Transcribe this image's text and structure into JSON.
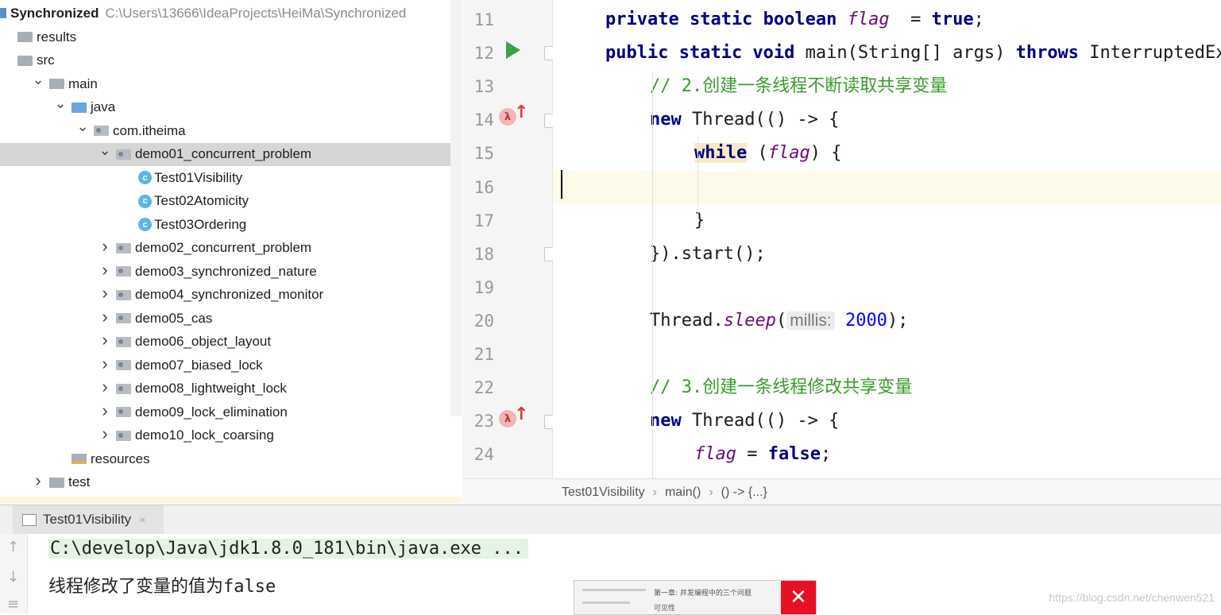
{
  "project": {
    "name": "Synchronized",
    "path": "C:\\Users\\13666\\IdeaProjects\\HeiMa\\Synchronized",
    "items": [
      {
        "label": "results",
        "indent": 0,
        "chevron": "",
        "icon": "folder"
      },
      {
        "label": "src",
        "indent": 0,
        "chevron": "",
        "icon": "folder"
      },
      {
        "label": "main",
        "indent": 1,
        "chevron": "down",
        "icon": "folder"
      },
      {
        "label": "java",
        "indent": 2,
        "chevron": "down",
        "icon": "folder-blue"
      },
      {
        "label": "com.itheima",
        "indent": 3,
        "chevron": "down",
        "icon": "package"
      },
      {
        "label": "demo01_concurrent_problem",
        "indent": 4,
        "chevron": "down",
        "icon": "package",
        "selected": true
      },
      {
        "label": "Test01Visibility",
        "indent": 5,
        "chevron": "",
        "icon": "class"
      },
      {
        "label": "Test02Atomicity",
        "indent": 5,
        "chevron": "",
        "icon": "class"
      },
      {
        "label": "Test03Ordering",
        "indent": 5,
        "chevron": "",
        "icon": "class"
      },
      {
        "label": "demo02_concurrent_problem",
        "indent": 4,
        "chevron": "right",
        "icon": "package"
      },
      {
        "label": "demo03_synchronized_nature",
        "indent": 4,
        "chevron": "right",
        "icon": "package"
      },
      {
        "label": "demo04_synchronized_monitor",
        "indent": 4,
        "chevron": "right",
        "icon": "package"
      },
      {
        "label": "demo05_cas",
        "indent": 4,
        "chevron": "right",
        "icon": "package"
      },
      {
        "label": "demo06_object_layout",
        "indent": 4,
        "chevron": "right",
        "icon": "package"
      },
      {
        "label": "demo07_biased_lock",
        "indent": 4,
        "chevron": "right",
        "icon": "package"
      },
      {
        "label": "demo08_lightweight_lock",
        "indent": 4,
        "chevron": "right",
        "icon": "package"
      },
      {
        "label": "demo09_lock_elimination",
        "indent": 4,
        "chevron": "right",
        "icon": "package"
      },
      {
        "label": "demo10_lock_coarsing",
        "indent": 4,
        "chevron": "right",
        "icon": "package"
      },
      {
        "label": "resources",
        "indent": 2,
        "chevron": "",
        "icon": "folder-res"
      },
      {
        "label": "test",
        "indent": 1,
        "chevron": "right",
        "icon": "folder"
      }
    ]
  },
  "editor": {
    "lines": [
      {
        "n": "11",
        "indent": 1,
        "tokens": [
          [
            "kw",
            "private static boolean "
          ],
          [
            "fld",
            "flag"
          ],
          [
            "",
            "  = "
          ],
          [
            "kw",
            "true"
          ],
          [
            "",
            ";"
          ]
        ]
      },
      {
        "n": "12",
        "indent": 1,
        "tokens": [
          [
            "kw",
            "public static void "
          ],
          [
            "",
            "main(String[] args) "
          ],
          [
            "kw",
            "throws "
          ],
          [
            "",
            "InterruptedException"
          ]
        ]
      },
      {
        "n": "13",
        "indent": 2,
        "tokens": [
          [
            "cm",
            "// 2.创建一条线程不断读取共享变量"
          ]
        ]
      },
      {
        "n": "14",
        "indent": 2,
        "tokens": [
          [
            "kw",
            "new "
          ],
          [
            "",
            "Thread(() -> {"
          ]
        ]
      },
      {
        "n": "15",
        "indent": 3,
        "tokens": [
          [
            "kw-while",
            "while"
          ],
          [
            "",
            " ("
          ],
          [
            "fld",
            "flag"
          ],
          [
            "",
            ") {"
          ]
        ]
      },
      {
        "n": "16",
        "indent": 0,
        "tokens": []
      },
      {
        "n": "17",
        "indent": 3,
        "tokens": [
          [
            "",
            "}"
          ]
        ]
      },
      {
        "n": "18",
        "indent": 2,
        "tokens": [
          [
            "",
            "}).start();"
          ]
        ]
      },
      {
        "n": "19",
        "indent": 0,
        "tokens": []
      },
      {
        "n": "20",
        "indent": 2,
        "tokens": [
          [
            "",
            "Thread."
          ],
          [
            "fld-it",
            "sleep"
          ],
          [
            "",
            "("
          ],
          [
            "hint",
            "millis:"
          ],
          [
            "num",
            " 2000"
          ],
          [
            "",
            ");"
          ]
        ]
      },
      {
        "n": "21",
        "indent": 0,
        "tokens": []
      },
      {
        "n": "22",
        "indent": 2,
        "tokens": [
          [
            "cm",
            "// 3.创建一条线程修改共享变量"
          ]
        ]
      },
      {
        "n": "23",
        "indent": 2,
        "tokens": [
          [
            "kw",
            "new "
          ],
          [
            "",
            "Thread(() -> {"
          ]
        ]
      },
      {
        "n": "24",
        "indent": 3,
        "tokens": [
          [
            "fld",
            "flag"
          ],
          [
            "",
            " = "
          ],
          [
            "kw",
            "false"
          ],
          [
            "",
            ";"
          ]
        ]
      }
    ]
  },
  "breadcrumb": {
    "items": [
      "Test01Visibility",
      "main()",
      "() -> {...}"
    ]
  },
  "run": {
    "tab_label": "Test01Visibility",
    "command": "C:\\develop\\Java\\jdk1.8.0_181\\bin\\java.exe ...",
    "output": "线程修改了变量的值为false"
  },
  "thumbnail": {
    "text": "第一章: 并发编程中的三个问题",
    "text2": "可见性"
  },
  "watermark": "https://blog.csdn.net/chenwen521",
  "colors": {
    "keyword": "#000080",
    "field": "#660e7a",
    "comment": "#3a9a2d",
    "number": "#0000ff",
    "selection": "#d6d6d6",
    "current_line": "#fdfae9"
  }
}
